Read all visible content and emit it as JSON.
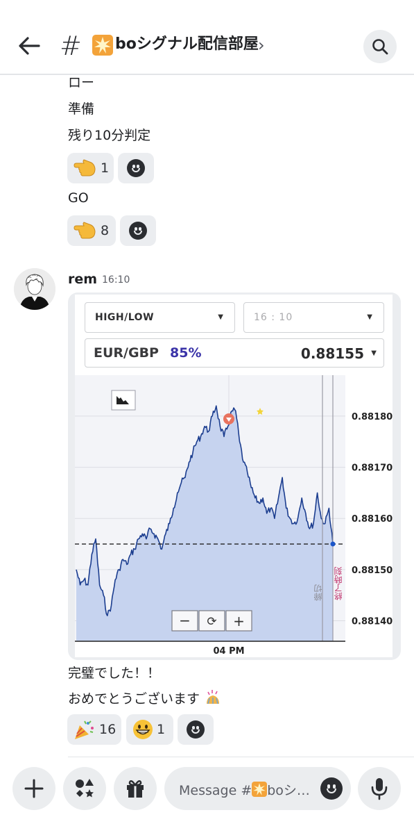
{
  "header": {
    "channel_prefix": "#",
    "channel_name": "boシグナル配信部屋",
    "chevron": "›",
    "back_icon": "arrow-left-icon",
    "search_icon": "search-icon"
  },
  "messages_prev": {
    "lines": [
      "ロー",
      "準備",
      "残り10分判定"
    ],
    "reactions_1": [
      {
        "emoji": "pointing-hand-emoji",
        "count": "1"
      }
    ],
    "line_go": "GO",
    "reactions_2": [
      {
        "emoji": "pointing-hand-emoji",
        "count": "8"
      }
    ]
  },
  "message": {
    "author": "rem",
    "time": "16:10",
    "text_1": "完璧でした！！",
    "text_2": "おめでとうございます",
    "reactions": [
      {
        "emoji": "party-popper-emoji",
        "count": "16"
      },
      {
        "emoji": "grinning-face-emoji",
        "count": "1"
      }
    ]
  },
  "trade": {
    "option_type": "HIGH/LOW",
    "expiry": "16 : 10",
    "pair": "EUR/GBP",
    "payout": "85%",
    "price": "0.88155",
    "x_tick": "04 PM",
    "label_cutoff": "締切",
    "label_end": "終了時刻",
    "zoom_out": "−",
    "zoom_reset": "⟳",
    "zoom_in": "+"
  },
  "chart_data": {
    "type": "line",
    "title": "",
    "xlabel": "",
    "ylabel": "",
    "x_ticks": [
      "04 PM"
    ],
    "y_ticks": [
      0.8814,
      0.8815,
      0.8816,
      0.8817,
      0.8818
    ],
    "y_tick_labels": [
      "0.88140",
      "0.88150",
      "0.88160",
      "0.88170",
      "0.88180"
    ],
    "ylim": [
      0.88136,
      0.88188
    ],
    "entry_price": 0.88155,
    "series": [
      {
        "values": [
          0.8815,
          0.88147,
          0.88148,
          0.88147,
          0.88153,
          0.88156,
          0.88147,
          0.88145,
          0.88141,
          0.88143,
          0.88148,
          0.8815,
          0.88152,
          0.88151,
          0.88153,
          0.88154,
          0.88156,
          0.88157,
          0.88156,
          0.88158,
          0.88157,
          0.88156,
          0.88154,
          0.88157,
          0.88159,
          0.88162,
          0.88165,
          0.88167,
          0.88168,
          0.88171,
          0.88173,
          0.88175,
          0.88176,
          0.88178,
          0.88177,
          0.8818,
          0.88182,
          0.88178,
          0.88176,
          0.88178,
          0.88181,
          0.88181,
          0.88175,
          0.88171,
          0.88169,
          0.88166,
          0.88164,
          0.88163,
          0.88164,
          0.88161,
          0.88162,
          0.8816,
          0.88164,
          0.88168,
          0.88162,
          0.8816,
          0.88159,
          0.8816,
          0.88164,
          0.88161,
          0.88158,
          0.88159,
          0.88165,
          0.8816,
          0.88159,
          0.88162,
          0.88155
        ]
      }
    ]
  },
  "composer": {
    "placeholder_prefix": "Message #",
    "placeholder_suffix": "boシ…"
  }
}
